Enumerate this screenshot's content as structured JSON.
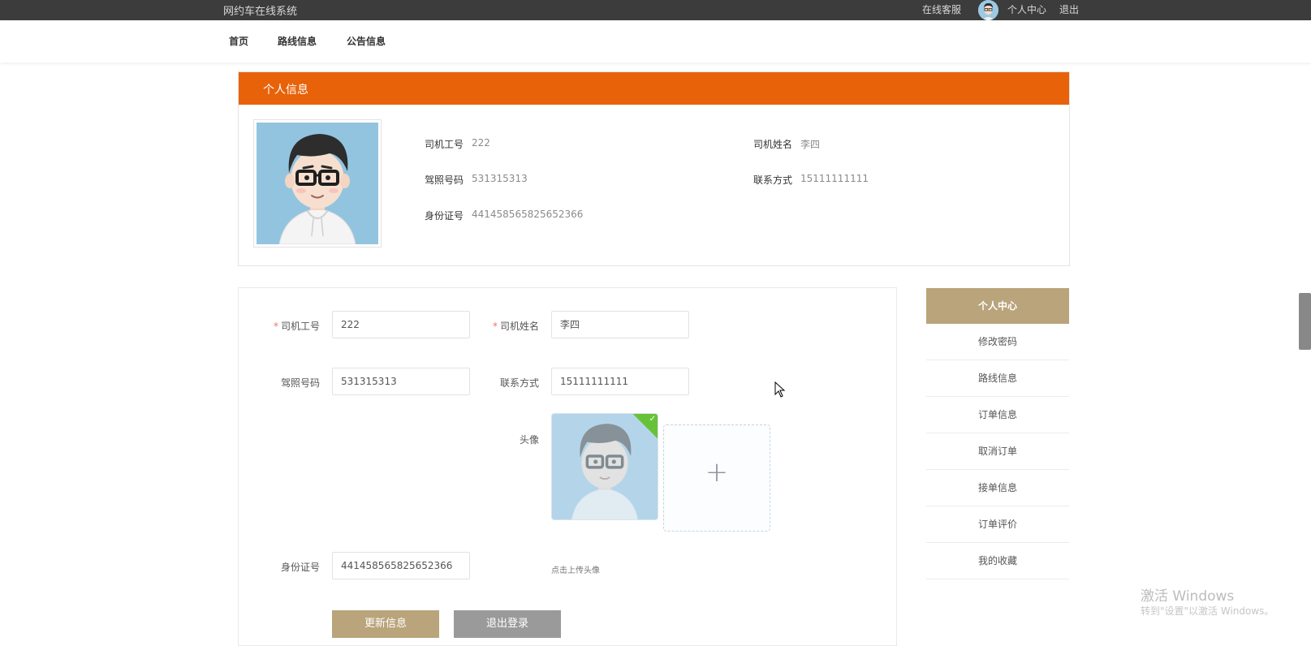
{
  "header": {
    "site_title": "网约车在线系统",
    "online_service": "在线客服",
    "user_center": "个人中心",
    "logout": "退出"
  },
  "nav": {
    "items": [
      {
        "label": "首页"
      },
      {
        "label": "路线信息"
      },
      {
        "label": "公告信息"
      }
    ]
  },
  "profile_card": {
    "title": "个人信息",
    "fields": {
      "driver_id": {
        "label": "司机工号",
        "value": "222"
      },
      "driver_name": {
        "label": "司机姓名",
        "value": "李四"
      },
      "license": {
        "label": "驾照号码",
        "value": "531315313"
      },
      "phone": {
        "label": "联系方式",
        "value": "15111111111"
      },
      "id_card": {
        "label": "身份证号",
        "value": "441458565825652366"
      }
    }
  },
  "form": {
    "required_mark": "*",
    "driver_id": {
      "label": "司机工号",
      "value": "222"
    },
    "driver_name": {
      "label": "司机姓名",
      "value": "李四"
    },
    "license": {
      "label": "驾照号码",
      "value": "531315313"
    },
    "phone": {
      "label": "联系方式",
      "value": "15111111111"
    },
    "avatar": {
      "label": "头像",
      "hint": "点击上传头像"
    },
    "id_card": {
      "label": "身份证号",
      "value": "441458565825652366"
    },
    "update_button": "更新信息",
    "logout_button": "退出登录"
  },
  "side_menu": {
    "header": "个人中心",
    "items": [
      {
        "label": "修改密码"
      },
      {
        "label": "路线信息"
      },
      {
        "label": "订单信息"
      },
      {
        "label": "取消订单"
      },
      {
        "label": "接单信息"
      },
      {
        "label": "订单评价"
      },
      {
        "label": "我的收藏"
      }
    ]
  },
  "watermark": {
    "title": "激活 Windows",
    "subtitle": "转到\"设置\"以激活 Windows。"
  },
  "colors": {
    "topbar": "#3c3c3c",
    "header_orange": "#e8620a",
    "accent_gold": "#b9a47b",
    "secondary_gray": "#9a9a9a",
    "required_red": "#f56c6c"
  }
}
